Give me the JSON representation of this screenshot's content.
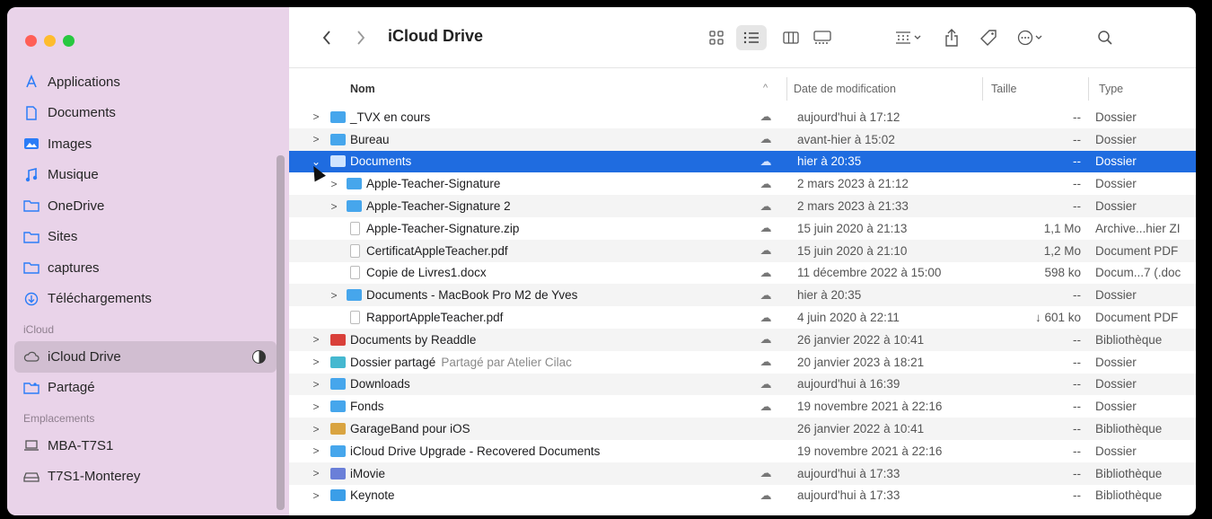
{
  "toolbar": {
    "title": "iCloud Drive",
    "back_icon": "chevron-left-icon",
    "forward_icon": "chevron-right-icon"
  },
  "sidebar": {
    "favorites": [
      {
        "label": "Applications",
        "icon": "apps-icon"
      },
      {
        "label": "Documents",
        "icon": "document-icon"
      },
      {
        "label": "Images",
        "icon": "photo-icon"
      },
      {
        "label": "Musique",
        "icon": "music-icon"
      },
      {
        "label": "OneDrive",
        "icon": "folder-icon"
      },
      {
        "label": "Sites",
        "icon": "folder-icon"
      },
      {
        "label": "captures",
        "icon": "folder-icon"
      },
      {
        "label": "Téléchargements",
        "icon": "download-icon"
      }
    ],
    "icloud_section": "iCloud",
    "icloud_items": [
      {
        "label": "iCloud Drive",
        "icon": "cloud-icon"
      },
      {
        "label": "Partagé",
        "icon": "shared-folder-icon"
      }
    ],
    "locations_section": "Emplacements",
    "locations": [
      {
        "label": "MBA-T7S1",
        "icon": "laptop-icon"
      },
      {
        "label": "T7S1-Monterey",
        "icon": "drive-icon"
      }
    ]
  },
  "columns": {
    "name": "Nom",
    "date": "Date de modification",
    "size": "Taille",
    "type": "Type"
  },
  "rows": [
    {
      "name": "_TVX en cours",
      "date": "aujourd'hui à 17:12",
      "size": "--",
      "type": "Dossier"
    },
    {
      "name": "Bureau",
      "date": "avant-hier à 15:02",
      "size": "--",
      "type": "Dossier"
    },
    {
      "name": "Documents",
      "date": "hier à 20:35",
      "size": "--",
      "type": "Dossier"
    },
    {
      "name": "Apple-Teacher-Signature",
      "date": "2 mars 2023 à 21:12",
      "size": "--",
      "type": "Dossier"
    },
    {
      "name": "Apple-Teacher-Signature 2",
      "date": "2 mars 2023 à 21:33",
      "size": "--",
      "type": "Dossier"
    },
    {
      "name": "Apple-Teacher-Signature.zip",
      "date": "15 juin 2020 à 21:13",
      "size": "1,1 Mo",
      "type": "Archive...hier ZI"
    },
    {
      "name": "CertificatAppleTeacher.pdf",
      "date": "15 juin 2020 à 21:10",
      "size": "1,2 Mo",
      "type": "Document PDF"
    },
    {
      "name": "Copie de Livres1.docx",
      "date": "11 décembre 2022 à 15:00",
      "size": "598 ko",
      "type": "Docum...7 (.doc"
    },
    {
      "name": "Documents - MacBook Pro M2 de Yves",
      "date": "hier à 20:35",
      "size": "--",
      "type": "Dossier"
    },
    {
      "name": "RapportAppleTeacher.pdf",
      "date": "4 juin 2020 à 22:11",
      "size": "↓ 601 ko",
      "type": "Document PDF"
    },
    {
      "name": "Documents by Readdle",
      "date": "26 janvier 2022 à 10:41",
      "size": "--",
      "type": "Bibliothèque"
    },
    {
      "name": "Dossier partagé",
      "shared": "Partagé par Atelier Cilac",
      "date": "20 janvier 2023 à 18:21",
      "size": "--",
      "type": "Dossier"
    },
    {
      "name": "Downloads",
      "date": "aujourd'hui à 16:39",
      "size": "--",
      "type": "Dossier"
    },
    {
      "name": "Fonds",
      "date": "19 novembre 2021 à 22:16",
      "size": "--",
      "type": "Dossier"
    },
    {
      "name": "GarageBand pour iOS",
      "date": "26 janvier 2022 à 10:41",
      "size": "--",
      "type": "Bibliothèque"
    },
    {
      "name": "iCloud Drive Upgrade - Recovered Documents",
      "date": "19 novembre 2021 à 22:16",
      "size": "--",
      "type": "Dossier"
    },
    {
      "name": "iMovie",
      "date": "aujourd'hui à 17:33",
      "size": "--",
      "type": "Bibliothèque"
    },
    {
      "name": "Keynote",
      "date": "aujourd'hui à 17:33",
      "size": "--",
      "type": "Bibliothèque"
    }
  ]
}
